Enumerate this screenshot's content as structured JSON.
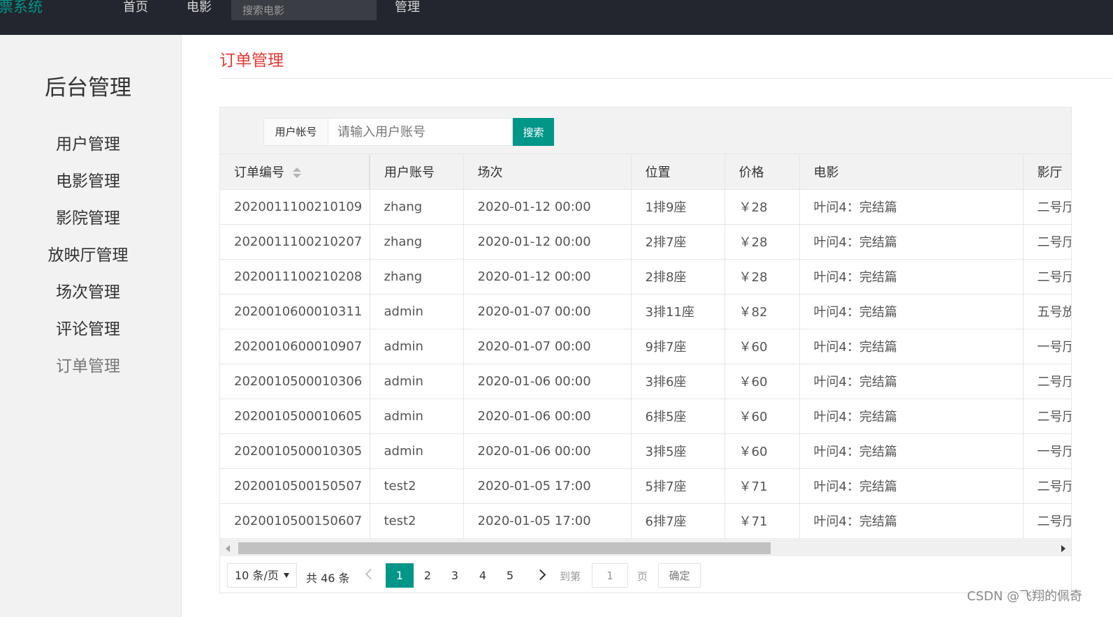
{
  "topnav": {
    "brand": "票系统",
    "home": "首页",
    "movies": "电影",
    "search_placeholder": "搜索电影",
    "admin": "管理"
  },
  "sidebar": {
    "title": "后台管理",
    "items": [
      {
        "label": "用户管理"
      },
      {
        "label": "电影管理"
      },
      {
        "label": "影院管理"
      },
      {
        "label": "放映厅管理"
      },
      {
        "label": "场次管理"
      },
      {
        "label": "评论管理"
      },
      {
        "label": "订单管理"
      }
    ]
  },
  "main": {
    "title": "订单管理",
    "search": {
      "label": "用户帐号",
      "placeholder": "请输入用户账号",
      "button": "搜索"
    },
    "table": {
      "headers": [
        "订单编号",
        "用户账号",
        "场次",
        "位置",
        "价格",
        "电影",
        "影厅"
      ],
      "rows": [
        [
          "2020011100210109",
          "zhang",
          "2020-01-12 00:00",
          "1排9座",
          "￥28",
          "叶问4：完结篇",
          "二号厅"
        ],
        [
          "2020011100210207",
          "zhang",
          "2020-01-12 00:00",
          "2排7座",
          "￥28",
          "叶问4：完结篇",
          "二号厅"
        ],
        [
          "2020011100210208",
          "zhang",
          "2020-01-12 00:00",
          "2排8座",
          "￥28",
          "叶问4：完结篇",
          "二号厅"
        ],
        [
          "2020010600010311",
          "admin",
          "2020-01-07 00:00",
          "3排11座",
          "￥82",
          "叶问4：完结篇",
          "五号放"
        ],
        [
          "2020010600010907",
          "admin",
          "2020-01-07 00:00",
          "9排7座",
          "￥60",
          "叶问4：完结篇",
          "一号厅"
        ],
        [
          "2020010500010306",
          "admin",
          "2020-01-06 00:00",
          "3排6座",
          "￥60",
          "叶问4：完结篇",
          "二号厅"
        ],
        [
          "2020010500010605",
          "admin",
          "2020-01-06 00:00",
          "6排5座",
          "￥60",
          "叶问4：完结篇",
          "二号厅"
        ],
        [
          "2020010500010305",
          "admin",
          "2020-01-06 00:00",
          "3排5座",
          "￥60",
          "叶问4：完结篇",
          "一号厅"
        ],
        [
          "2020010500150507",
          "test2",
          "2020-01-05 17:00",
          "5排7座",
          "￥71",
          "叶问4：完结篇",
          "二号厅"
        ],
        [
          "2020010500150607",
          "test2",
          "2020-01-05 17:00",
          "6排7座",
          "￥71",
          "叶问4：完结篇",
          "二号厅"
        ]
      ]
    },
    "pagination": {
      "page_size": "10 条/页",
      "total": "共 46 条",
      "pages": [
        "1",
        "2",
        "3",
        "4",
        "5"
      ],
      "current_page": "1",
      "goto_label": "到第",
      "goto_value": "1",
      "page_unit": "页",
      "confirm": "确定"
    }
  },
  "watermark": "CSDN @飞翔的佩奇",
  "colors": {
    "topbar": "#23262e",
    "brand": "#009688",
    "accent": "#009688",
    "page_title": "#e53935"
  }
}
